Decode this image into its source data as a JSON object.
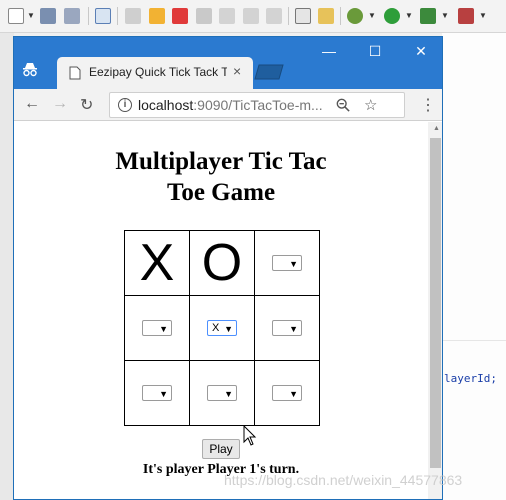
{
  "tab": {
    "title": "Eezipay Quick Tick Tack T",
    "close": "×"
  },
  "window": {
    "minimize": "—",
    "maximize": "☐",
    "close": "✕"
  },
  "address": {
    "host": "localhost",
    "rest": ":9090/TicTacToe-m..."
  },
  "page": {
    "heading_line1": "Multiplayer Tic Tac",
    "heading_line2": "Toe Game",
    "board": [
      {
        "type": "mark",
        "value": "X"
      },
      {
        "type": "mark",
        "value": "O"
      },
      {
        "type": "select",
        "value": ""
      },
      {
        "type": "select",
        "value": ""
      },
      {
        "type": "select",
        "value": "X",
        "focused": true
      },
      {
        "type": "select",
        "value": ""
      },
      {
        "type": "select",
        "value": ""
      },
      {
        "type": "select",
        "value": ""
      },
      {
        "type": "select",
        "value": ""
      }
    ],
    "play_label": "Play",
    "status": "It's player Player 1's turn."
  },
  "ide": {
    "code_text": "layerId;"
  },
  "watermark": "https://blog.csdn.net/weixin_44577863",
  "icons": [
    "incognito-icon",
    "page-icon",
    "back-icon",
    "forward-icon",
    "reload-icon",
    "info-icon",
    "zoom-icon",
    "star-icon",
    "menu-icon",
    "cursor-icon"
  ]
}
